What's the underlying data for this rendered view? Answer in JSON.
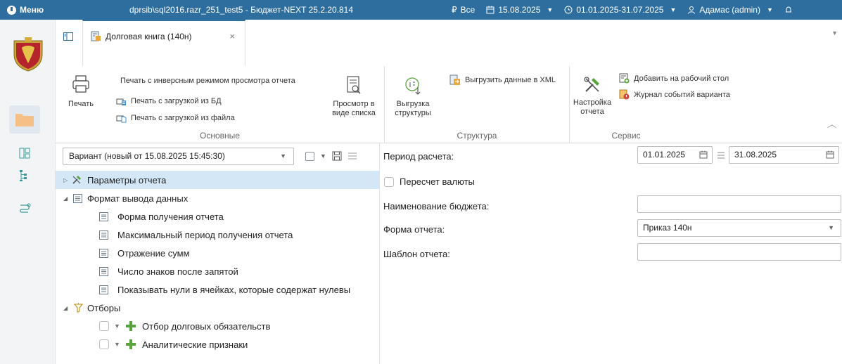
{
  "titlebar": {
    "menu_label": "Меню",
    "app_title": "dprsib\\sql2016.razr_251_test5 - Бюджет-NEXT 25.2.20.814",
    "currency_label": "Все",
    "date_label": "15.08.2025",
    "period_label": "01.01.2025-31.07.2025",
    "user_label": "Адамас (admin)"
  },
  "tabs": {
    "active_tab_label": "Долговая книга (140н)",
    "close_symbol": "×"
  },
  "ribbon": {
    "groups": {
      "main": "Основные",
      "structure": "Структура",
      "service": "Сервис"
    },
    "print_label": "Печать",
    "print_inverse_label": "Печать с инверсным режимом просмотра отчета",
    "print_db_label": "Печать с загрузкой из БД",
    "print_file_label": "Печать с загрузкой из файла",
    "list_view_label_1": "Просмотр в",
    "list_view_label_2": "виде списка",
    "export_structure_label_1": "Выгрузка",
    "export_structure_label_2": "структуры",
    "export_xml_label": "Выгрузить данные в XML",
    "report_settings_label_1": "Настройка",
    "report_settings_label_2": "отчета",
    "add_desktop_label": "Добавить на рабочий стол",
    "event_log_label": "Журнал событий варианта"
  },
  "left_panel": {
    "variant_value": "Вариант (новый от 15.08.2025 15:45:30)",
    "tree": [
      {
        "label": "Параметры отчета"
      },
      {
        "label": "Формат вывода данных"
      },
      {
        "label": "Форма получения отчета"
      },
      {
        "label": "Максимальный период получения отчета"
      },
      {
        "label": "Отражение сумм"
      },
      {
        "label": "Число знаков после запятой"
      },
      {
        "label": "Показывать нули в ячейках, которые содержат нулевы"
      },
      {
        "label": "Отборы"
      },
      {
        "label": "Отбор долговых обязательств"
      },
      {
        "label": "Аналитические признаки"
      }
    ]
  },
  "right_panel": {
    "period_label": "Период расчета:",
    "period_from": "01.01.2025",
    "period_to": "31.08.2025",
    "currency_recalc_label": "Пересчет валюты",
    "budget_name_label": "Наименование бюджета:",
    "budget_name_value": "",
    "report_form_label": "Форма отчета:",
    "report_form_value": "Приказ 140н",
    "report_template_label": "Шаблон отчета:",
    "report_template_value": ""
  },
  "colors": {
    "titlebar": "#2d6e9e",
    "selected_row": "#d3e7f7",
    "folder_orange": "#f5c088",
    "green_plus": "#5aa33b"
  }
}
